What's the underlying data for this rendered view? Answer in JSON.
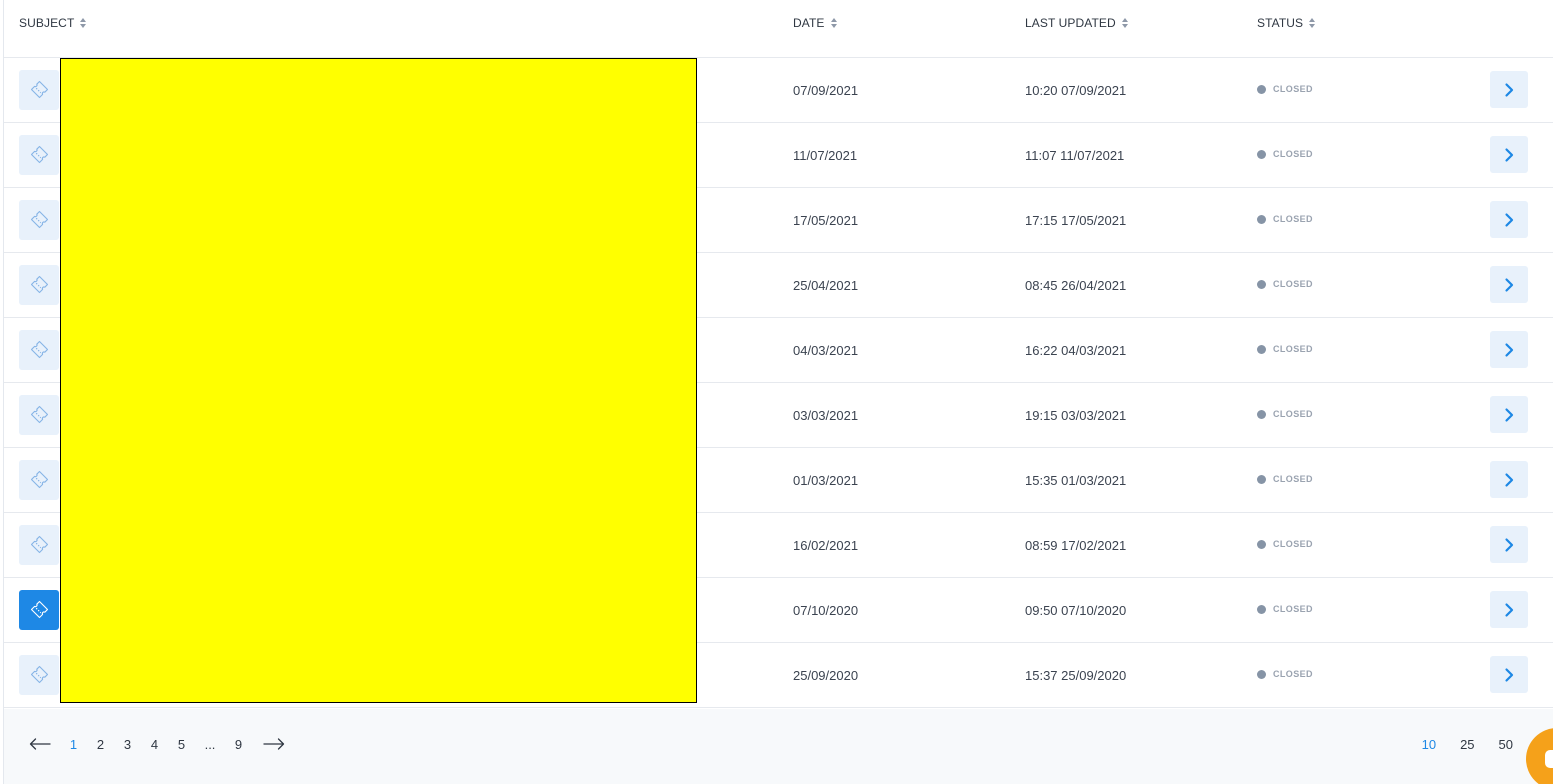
{
  "header": {
    "subject": "SUBJECT",
    "date": "DATE",
    "last_updated": "LAST UPDATED",
    "status": "STATUS"
  },
  "rows": [
    {
      "date": "07/09/2021",
      "updated": "10:20 07/09/2021",
      "status": "CLOSED",
      "active": false
    },
    {
      "date": "11/07/2021",
      "updated": "11:07 11/07/2021",
      "status": "CLOSED",
      "active": false
    },
    {
      "date": "17/05/2021",
      "updated": "17:15 17/05/2021",
      "status": "CLOSED",
      "active": false
    },
    {
      "date": "25/04/2021",
      "updated": "08:45 26/04/2021",
      "status": "CLOSED",
      "active": false
    },
    {
      "date": "04/03/2021",
      "updated": "16:22 04/03/2021",
      "status": "CLOSED",
      "active": false
    },
    {
      "date": "03/03/2021",
      "updated": "19:15 03/03/2021",
      "status": "CLOSED",
      "active": false
    },
    {
      "date": "01/03/2021",
      "updated": "15:35 01/03/2021",
      "status": "CLOSED",
      "active": false
    },
    {
      "date": "16/02/2021",
      "updated": "08:59 17/02/2021",
      "status": "CLOSED",
      "active": false
    },
    {
      "date": "07/10/2020",
      "updated": "09:50 07/10/2020",
      "status": "CLOSED",
      "active": true
    },
    {
      "date": "25/09/2020",
      "updated": "15:37 25/09/2020",
      "status": "CLOSED",
      "active": false
    }
  ],
  "pagination": {
    "prev_icon": "arrow-left-icon",
    "next_icon": "arrow-right-icon",
    "pages": [
      "1",
      "2",
      "3",
      "4",
      "5"
    ],
    "ellipsis": "...",
    "last_page": "9",
    "current": "1"
  },
  "per_page": {
    "options": [
      "10",
      "25",
      "50"
    ],
    "selected": "10"
  },
  "icons": {
    "row_icon": "ticket-icon",
    "action_icon": "chevron-right-icon",
    "chat": "chat-icon"
  },
  "colors": {
    "accent": "#1e88e5",
    "accent_light": "#e8f1fb",
    "status_closed": "#8694a6",
    "redaction": "#ffff00",
    "chat_button": "#f5a11a"
  }
}
